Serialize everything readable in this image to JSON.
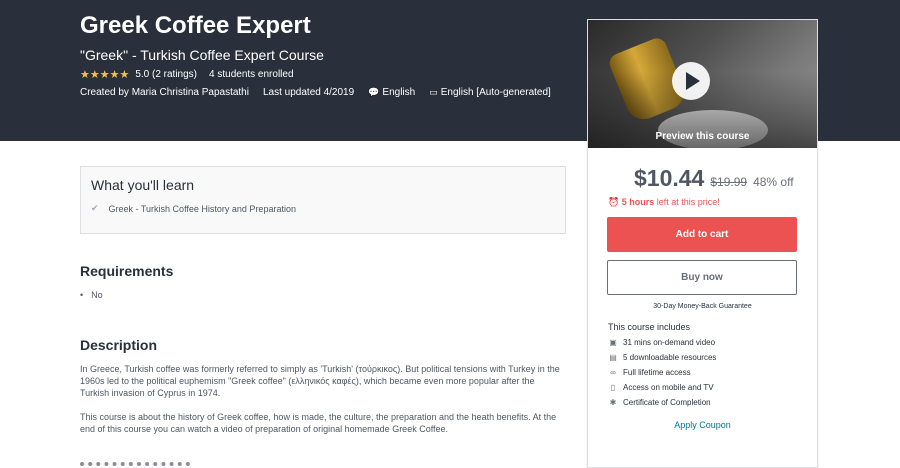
{
  "course": {
    "title": "Greek Coffee Expert",
    "subtitle": "\"Greek\" - Turkish Coffee Expert Course",
    "stars": "★★★★★",
    "rating": "5.0 (2 ratings)",
    "enrolled": "4 students enrolled",
    "created_by": "Created by Maria Christina Papastathi",
    "last_updated": "Last updated 4/2019",
    "language": "English",
    "captions": "English [Auto-generated]",
    "language_icon": "speech-bubble-icon",
    "captions_icon": "closed-captions-icon"
  },
  "sidebar": {
    "preview_label": "Preview this course",
    "price": "$10.44",
    "original_price": "$19.99",
    "discount": "48% off",
    "timer_bold": "5 hours",
    "timer_rest": " left at this price!",
    "add_to_cart": "Add to cart",
    "buy_now": "Buy now",
    "guarantee": "30-Day Money-Back Guarantee",
    "includes_title": "This course includes",
    "includes": [
      {
        "icon": "video-icon",
        "glyph": "▣",
        "label": "31 mins on-demand video"
      },
      {
        "icon": "file-icon",
        "glyph": "▤",
        "label": "5 downloadable resources"
      },
      {
        "icon": "infinity-icon",
        "glyph": "∞",
        "label": "Full lifetime access"
      },
      {
        "icon": "mobile-icon",
        "glyph": "▯",
        "label": "Access on mobile and TV"
      },
      {
        "icon": "certificate-icon",
        "glyph": "✱",
        "label": "Certificate of Completion"
      }
    ],
    "apply_coupon": "Apply Coupon"
  },
  "learn": {
    "heading": "What you'll learn",
    "items": [
      "Greek - Turkish Coffee History and Preparation"
    ]
  },
  "requirements": {
    "heading": "Requirements",
    "items": [
      "No"
    ]
  },
  "description": {
    "heading": "Description",
    "paragraphs": [
      "In Greece, Turkish coffee was formerly referred to simply as 'Turkish' (τούρκικος). But political tensions with Turkey in the 1960s led to the political euphemism \"Greek coffee\" (ελληνικός καφές), which became even more popular after the Turkish invasion of Cyprus in 1974.",
      "This course is about the history of Greek coffee, how is made, the culture, the preparation and the heath benefits. At the end of this course you can watch a video of preparation of original homemade Greek Coffee."
    ]
  },
  "colors": {
    "header_bg": "#29303b",
    "accent_red": "#ec5252",
    "star_gold": "#f4c150",
    "link_blue": "#007791"
  }
}
